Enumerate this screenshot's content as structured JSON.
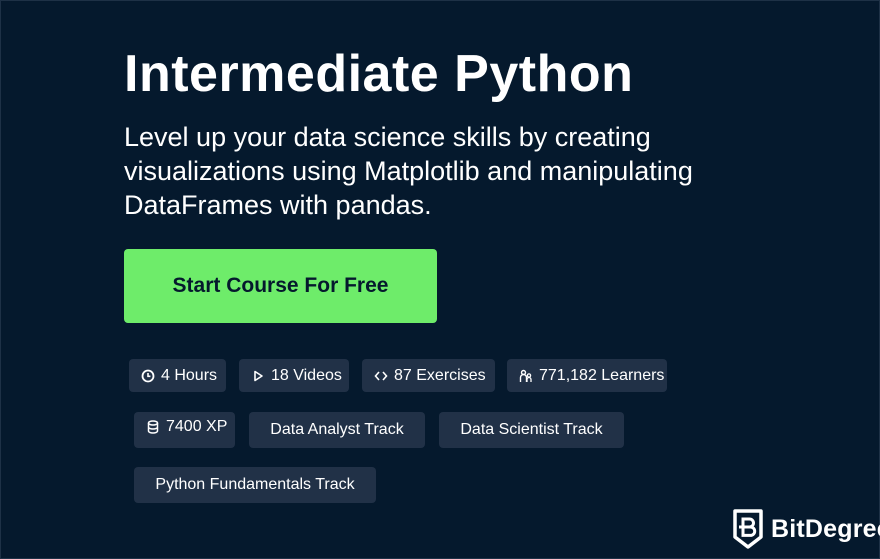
{
  "course": {
    "title": "Intermediate Python",
    "description": "Level up your data science skills by creating visualizations using Matplotlib and manipulating DataFrames with pandas.",
    "cta_label": "Start Course For Free"
  },
  "stats": [
    {
      "icon": "clock-icon",
      "label": "4 Hours"
    },
    {
      "icon": "play-icon",
      "label": "18 Videos"
    },
    {
      "icon": "code-icon",
      "label": "87 Exercises"
    },
    {
      "icon": "learners-icon",
      "label": "771,182 Learners"
    },
    {
      "icon": "database-icon",
      "label": "7400 XP"
    }
  ],
  "tracks": [
    {
      "label": "Data Analyst Track"
    },
    {
      "label": "Data Scientist Track"
    },
    {
      "label": "Python Fundamentals Track"
    }
  ],
  "watermark": {
    "icon": "bitdegree-shield-icon",
    "label": "BitDegree"
  },
  "colors": {
    "background": "#05192d",
    "cta": "#6eec6a",
    "chip": "#213147"
  }
}
